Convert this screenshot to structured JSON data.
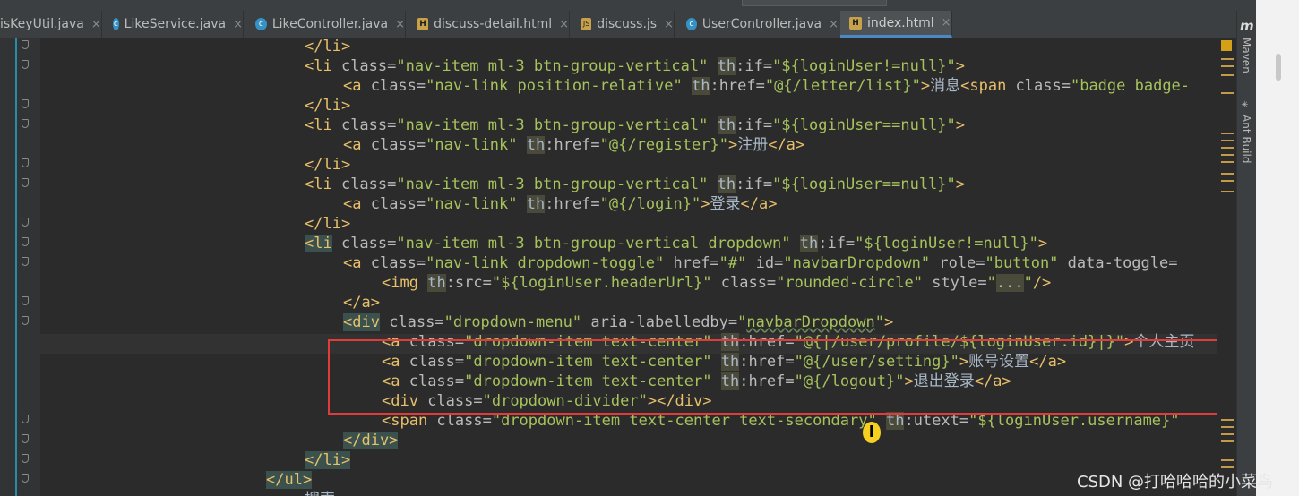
{
  "tabs": [
    {
      "label": "isKeyUtil.java",
      "icon": "none"
    },
    {
      "label": "LikeService.java",
      "icon": "class"
    },
    {
      "label": "LikeController.java",
      "icon": "class"
    },
    {
      "label": "discuss-detail.html",
      "icon": "html"
    },
    {
      "label": "discuss.js",
      "icon": "js"
    },
    {
      "label": "UserController.java",
      "icon": "class"
    },
    {
      "label": "index.html",
      "icon": "html",
      "active": true
    }
  ],
  "tab_close_glyph": "×",
  "code": {
    "l1": {
      "close": "</li>"
    },
    "l2": {
      "open": "<li",
      "cls": " class=",
      "clsv": "\"nav-item ml-3 btn-group-vertical\"",
      "th": "th",
      "attr": ":if=",
      "val": "\"${loginUser!=null}\"",
      "end": ">"
    },
    "l3": {
      "open": "<a",
      "cls": " class=",
      "clsv": "\"nav-link position-relative\"",
      "th": "th",
      "attr": ":href=",
      "val": "\"@{/letter/list}\"",
      "end": ">",
      "text": "消息",
      "tail": "<span",
      "tail_attr": " class=",
      "tail_val": "\"badge badge-"
    },
    "l4": {
      "close": "</li>"
    },
    "l5": {
      "open": "<li",
      "cls": " class=",
      "clsv": "\"nav-item ml-3 btn-group-vertical\"",
      "th": "th",
      "attr": ":if=",
      "val": "\"${loginUser==null}\"",
      "end": ">"
    },
    "l6": {
      "open": "<a",
      "cls": " class=",
      "clsv": "\"nav-link\"",
      "th": "th",
      "attr": ":href=",
      "val": "\"@{/register}\"",
      "end": ">",
      "text": "注册",
      "close": "</a>"
    },
    "l7": {
      "close": "</li>"
    },
    "l8": {
      "open": "<li",
      "cls": " class=",
      "clsv": "\"nav-item ml-3 btn-group-vertical\"",
      "th": "th",
      "attr": ":if=",
      "val": "\"${loginUser==null}\"",
      "end": ">"
    },
    "l9": {
      "open": "<a",
      "cls": " class=",
      "clsv": "\"nav-link\"",
      "th": "th",
      "attr": ":href=",
      "val": "\"@{/login}\"",
      "end": ">",
      "text": "登录",
      "close": "</a>"
    },
    "l10": {
      "close": "</li>"
    },
    "l11": {
      "open": "<li",
      "cls": " class=",
      "clsv": "\"nav-item ml-3 btn-group-vertical dropdown\"",
      "th": "th",
      "attr": ":if=",
      "val": "\"${loginUser!=null}\"",
      "end": ">"
    },
    "l12": {
      "open": "<a",
      "cls": " class=",
      "clsv": "\"nav-link dropdown-toggle\"",
      "a2": " href=",
      "v2": "\"#\"",
      "a3": " id=",
      "v3": "\"navbarDropdown\"",
      "a4": " role=",
      "v4": "\"button\"",
      "a5": " data-toggle="
    },
    "l13": {
      "open": "<img",
      "sp": " ",
      "th": "th",
      "attr": ":src=",
      "val": "\"${loginUser.headerUrl}\"",
      "a2": " class=",
      "v2": "\"rounded-circle\"",
      "a3": " style=",
      "v3a": "\"",
      "v3b": "...",
      "v3c": "\"",
      "end": "/>"
    },
    "l14": {
      "close": "</a>"
    },
    "l15": {
      "open": "<div",
      "cls": " class=",
      "clsv": "\"dropdown-menu\"",
      "a2": " aria-labelledby=",
      "v2a": "\"",
      "v2b": "navbarDropdown",
      "v2c": "\"",
      "end": ">"
    },
    "l16": {
      "open": "<a",
      "cls": " class=",
      "clsv": "\"dropdown-item text-center\"",
      "th": "th",
      "attr": ":href=",
      "val": "\"@{|/user/profile/${loginUser.id}|}\"",
      "end": ">",
      "text": "个人主页"
    },
    "l17": {
      "open": "<a",
      "cls": " class=",
      "clsv": "\"dropdown-item text-center\"",
      "th": "th",
      "attr": ":href=",
      "val": "\"@{/user/setting}\"",
      "end": ">",
      "text": "账号设置",
      "close": "</a>"
    },
    "l18": {
      "open": "<a",
      "cls": " class=",
      "clsv": "\"dropdown-item text-center\"",
      "th": "th",
      "attr": ":href=",
      "val": "\"@{/logout}\"",
      "end": ">",
      "text": "退出登录",
      "close": "</a>"
    },
    "l19": {
      "open": "<div",
      "cls": " class=",
      "clsv": "\"dropdown-divider\"",
      "end": "></div>"
    },
    "l20": {
      "open": "<span",
      "cls": " class=",
      "clsv": "\"dropdown-item text-center text-secondary\"",
      "th": "th",
      "attr": ":utext=",
      "val": "\"${loginUser.username}\""
    },
    "l21": {
      "close": "</div>"
    },
    "l22": {
      "close": "</li>"
    },
    "l23": {
      "close": "</ul>"
    },
    "l24": {
      "text": "搜索"
    }
  },
  "right_tools": {
    "maven_icon": "m",
    "maven": "Maven",
    "ant": "Ant Build"
  },
  "watermark": "CSDN @打哈哈哈的小菜鸟",
  "cursor_glyph": "I",
  "colors": {
    "tag": "#e8bf6a",
    "attr": "#bababa",
    "value": "#a5c25c",
    "text": "#a9b7c6",
    "background": "#2b2b2b",
    "highlight_box": "#e03c3c"
  }
}
